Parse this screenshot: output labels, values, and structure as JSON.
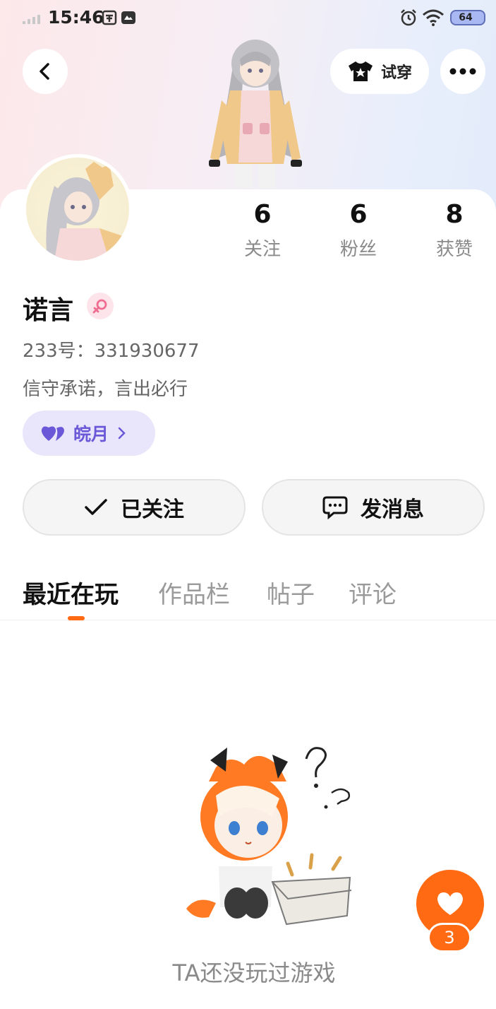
{
  "status_bar": {
    "time": "15:46",
    "battery": "64"
  },
  "header": {
    "try_on_label": "试穿",
    "icons": [
      "back-arrow-icon",
      "shirt-icon",
      "more-dots-icon"
    ]
  },
  "stats": [
    {
      "value": "6",
      "label": "关注"
    },
    {
      "value": "6",
      "label": "粉丝"
    },
    {
      "value": "8",
      "label": "获赞"
    }
  ],
  "profile": {
    "name": "诺言",
    "id_line": "233号：331930677",
    "bio": "信守承诺，言出必行",
    "tag_label": "皖月"
  },
  "actions": {
    "follow_label": "已关注",
    "message_label": "发消息"
  },
  "tabs": [
    "最近在玩",
    "作品栏",
    "帖子",
    "评论"
  ],
  "empty_state": {
    "text": "TA还没玩过游戏"
  },
  "like_fab": {
    "count": "3"
  },
  "colors": {
    "accent": "#ff6a13",
    "tag_bg": "#e9e6fb",
    "tag_text": "#6a58d8"
  }
}
